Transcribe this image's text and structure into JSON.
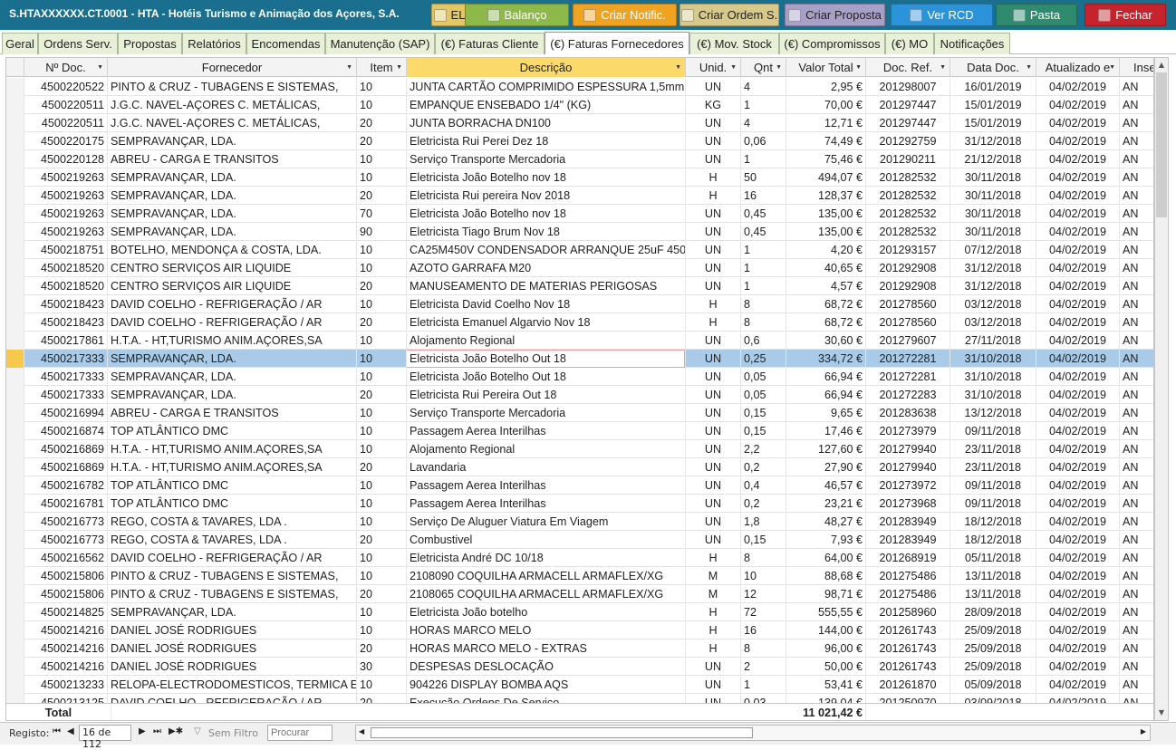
{
  "window": {
    "title": "S.HTAXXXXXX.CT.0001 - HTA - Hotéis Turismo e Animação dos Açores, S.A."
  },
  "toolbar": [
    {
      "key": "rel",
      "label": "EL",
      "icon": "document-icon",
      "bg": "#e3c763",
      "color": "#222"
    },
    {
      "key": "balanco",
      "label": "Balanço",
      "icon": "pie-chart-icon",
      "bg": "#8db94a",
      "color": "#fff"
    },
    {
      "key": "criar_notific",
      "label": "Criar Notific.",
      "icon": "checklist-icon",
      "bg": "#f0a320",
      "color": "#fff"
    },
    {
      "key": "criar_ordem",
      "label": "Criar Ordem S.",
      "icon": "clipboard-icon",
      "bg": "#d8c98a",
      "color": "#222"
    },
    {
      "key": "criar_proposta",
      "label": "Criar Proposta",
      "icon": "proposal-icon",
      "bg": "#a9a0c9",
      "color": "#222"
    },
    {
      "key": "ver_rcd",
      "label": "Ver RCD",
      "icon": "globe-icon",
      "bg": "#2b93d9",
      "color": "#fff"
    },
    {
      "key": "pasta",
      "label": "Pasta",
      "icon": "folder-icon",
      "bg": "#2e8b6e",
      "color": "#fff"
    },
    {
      "key": "fechar",
      "label": "Fechar",
      "icon": "close-icon",
      "bg": "#c7232c",
      "color": "#fff"
    }
  ],
  "tabs": [
    "Geral",
    "Ordens Serv.",
    "Propostas",
    "Relatórios",
    "Encomendas",
    "Manutenção (SAP)",
    "(€) Faturas Cliente",
    "(€) Faturas Fornecedores",
    "(€) Mov. Stock",
    "(€) Compromissos",
    "(€) MO",
    "Notificações"
  ],
  "active_tab": "(€) Faturas Fornecedores",
  "columns": [
    {
      "key": "doc",
      "label": "Nº Doc."
    },
    {
      "key": "forn",
      "label": "Fornecedor"
    },
    {
      "key": "item",
      "label": "Item"
    },
    {
      "key": "desc",
      "label": "Descrição"
    },
    {
      "key": "unid",
      "label": "Unid."
    },
    {
      "key": "qnt",
      "label": "Qnt"
    },
    {
      "key": "valor",
      "label": "Valor Total"
    },
    {
      "key": "ref",
      "label": "Doc. Ref."
    },
    {
      "key": "data",
      "label": "Data Doc."
    },
    {
      "key": "atual",
      "label": "Atualizado e"
    },
    {
      "key": "ins",
      "label": "Inser"
    }
  ],
  "rows": [
    [
      "4500220522",
      "PINTO & CRUZ - TUBAGENS E SISTEMAS,",
      "10",
      "JUNTA CARTÃO COMPRIMIDO ESPESSURA 1,5mm",
      "UN",
      "4",
      "2,95 €",
      "201298007",
      "16/01/2019",
      "04/02/2019",
      "AN"
    ],
    [
      "4500220511",
      "J.G.C. NAVEL-AÇORES C. METÁLICAS,",
      "10",
      "EMPANQUE ENSEBADO 1/4\" (KG)",
      "KG",
      "1",
      "70,00 €",
      "201297447",
      "15/01/2019",
      "04/02/2019",
      "AN"
    ],
    [
      "4500220511",
      "J.G.C. NAVEL-AÇORES C. METÁLICAS,",
      "20",
      "JUNTA BORRACHA DN100",
      "UN",
      "4",
      "12,71 €",
      "201297447",
      "15/01/2019",
      "04/02/2019",
      "AN"
    ],
    [
      "4500220175",
      "SEMPRAVANÇAR, LDA.",
      "20",
      "Eletricista Rui Perei Dez 18",
      "UN",
      "0,06",
      "74,49 €",
      "201292759",
      "31/12/2018",
      "04/02/2019",
      "AN"
    ],
    [
      "4500220128",
      "ABREU - CARGA E TRANSITOS",
      "10",
      "Serviço Transporte Mercadoria",
      "UN",
      "1",
      "75,46 €",
      "201290211",
      "21/12/2018",
      "04/02/2019",
      "AN"
    ],
    [
      "4500219263",
      "SEMPRAVANÇAR, LDA.",
      "10",
      "Eletricista João Botelho nov 18",
      "H",
      "50",
      "494,07 €",
      "201282532",
      "30/11/2018",
      "04/02/2019",
      "AN"
    ],
    [
      "4500219263",
      "SEMPRAVANÇAR, LDA.",
      "20",
      "Eletricista Rui pereira Nov 2018",
      "H",
      "16",
      "128,37 €",
      "201282532",
      "30/11/2018",
      "04/02/2019",
      "AN"
    ],
    [
      "4500219263",
      "SEMPRAVANÇAR, LDA.",
      "70",
      "Eletricista João Botelho nov 18",
      "UN",
      "0,45",
      "135,00 €",
      "201282532",
      "30/11/2018",
      "04/02/2019",
      "AN"
    ],
    [
      "4500219263",
      "SEMPRAVANÇAR, LDA.",
      "90",
      "Eletricista Tiago Brum Nov 18",
      "UN",
      "0,45",
      "135,00 €",
      "201282532",
      "30/11/2018",
      "04/02/2019",
      "AN"
    ],
    [
      "4500218751",
      "BOTELHO, MENDONÇA & COSTA, LDA.",
      "10",
      "CA25M450V CONDENSADOR ARRANQUE 25uF 450",
      "UN",
      "1",
      "4,20 €",
      "201293157",
      "07/12/2018",
      "04/02/2019",
      "AN"
    ],
    [
      "4500218520",
      "CENTRO SERVIÇOS AIR LIQUIDE",
      "10",
      "AZOTO GARRAFA M20",
      "UN",
      "1",
      "40,65 €",
      "201292908",
      "31/12/2018",
      "04/02/2019",
      "AN"
    ],
    [
      "4500218520",
      "CENTRO SERVIÇOS AIR LIQUIDE",
      "20",
      "MANUSEAMENTO DE MATERIAS PERIGOSAS",
      "UN",
      "1",
      "4,57 €",
      "201292908",
      "31/12/2018",
      "04/02/2019",
      "AN"
    ],
    [
      "4500218423",
      "DAVID COELHO - REFRIGERAÇÃO / AR",
      "10",
      "Eletricista David Coelho Nov 18",
      "H",
      "8",
      "68,72 €",
      "201278560",
      "03/12/2018",
      "04/02/2019",
      "AN"
    ],
    [
      "4500218423",
      "DAVID COELHO - REFRIGERAÇÃO / AR",
      "20",
      "Eletricista Emanuel Algarvio Nov 18",
      "H",
      "8",
      "68,72 €",
      "201278560",
      "03/12/2018",
      "04/02/2019",
      "AN"
    ],
    [
      "4500217861",
      "H.T.A. - HT,TURISMO ANIM.AÇORES,SA",
      "10",
      "Alojamento Regional",
      "UN",
      "0,6",
      "30,60 €",
      "201279607",
      "27/11/2018",
      "04/02/2019",
      "AN"
    ],
    [
      "4500217333",
      "SEMPRAVANÇAR, LDA.",
      "10",
      "Eletricista João Botelho Out 18",
      "UN",
      "0,25",
      "334,72 €",
      "201272281",
      "31/10/2018",
      "04/02/2019",
      "AN"
    ],
    [
      "4500217333",
      "SEMPRAVANÇAR, LDA.",
      "10",
      "Eletricista João Botelho Out 18",
      "UN",
      "0,05",
      "66,94 €",
      "201272281",
      "31/10/2018",
      "04/02/2019",
      "AN"
    ],
    [
      "4500217333",
      "SEMPRAVANÇAR, LDA.",
      "20",
      "Eletricista Rui Pereira Out 18",
      "UN",
      "0,05",
      "66,94 €",
      "201272283",
      "31/10/2018",
      "04/02/2019",
      "AN"
    ],
    [
      "4500216994",
      "ABREU - CARGA E TRANSITOS",
      "10",
      "Serviço Transporte Mercadoria",
      "UN",
      "0,15",
      "9,65 €",
      "201283638",
      "13/12/2018",
      "04/02/2019",
      "AN"
    ],
    [
      "4500216874",
      "TOP ATLÂNTICO DMC",
      "10",
      "Passagem Aerea Interilhas",
      "UN",
      "0,15",
      "17,46 €",
      "201273979",
      "09/11/2018",
      "04/02/2019",
      "AN"
    ],
    [
      "4500216869",
      "H.T.A. - HT,TURISMO ANIM.AÇORES,SA",
      "10",
      "Alojamento Regional",
      "UN",
      "2,2",
      "127,60 €",
      "201279940",
      "23/11/2018",
      "04/02/2019",
      "AN"
    ],
    [
      "4500216869",
      "H.T.A. - HT,TURISMO ANIM.AÇORES,SA",
      "20",
      "Lavandaria",
      "UN",
      "0,2",
      "27,90 €",
      "201279940",
      "23/11/2018",
      "04/02/2019",
      "AN"
    ],
    [
      "4500216782",
      "TOP ATLÂNTICO DMC",
      "10",
      "Passagem Aerea Interilhas",
      "UN",
      "0,4",
      "46,57 €",
      "201273972",
      "09/11/2018",
      "04/02/2019",
      "AN"
    ],
    [
      "4500216781",
      "TOP ATLÂNTICO DMC",
      "10",
      "Passagem Aerea Interilhas",
      "UN",
      "0,2",
      "23,21 €",
      "201273968",
      "09/11/2018",
      "04/02/2019",
      "AN"
    ],
    [
      "4500216773",
      "REGO, COSTA & TAVARES, LDA .",
      "10",
      "Serviço De Aluguer Viatura Em Viagem",
      "UN",
      "1,8",
      "48,27 €",
      "201283949",
      "18/12/2018",
      "04/02/2019",
      "AN"
    ],
    [
      "4500216773",
      "REGO, COSTA & TAVARES, LDA .",
      "20",
      "Combustivel",
      "UN",
      "0,15",
      "7,93 €",
      "201283949",
      "18/12/2018",
      "04/02/2019",
      "AN"
    ],
    [
      "4500216562",
      "DAVID COELHO - REFRIGERAÇÃO / AR",
      "10",
      "Eletricista André DC 10/18",
      "H",
      "8",
      "64,00 €",
      "201268919",
      "05/11/2018",
      "04/02/2019",
      "AN"
    ],
    [
      "4500215806",
      "PINTO & CRUZ - TUBAGENS E SISTEMAS,",
      "10",
      "2108090 COQUILHA ARMACELL ARMAFLEX/XG",
      "M",
      "10",
      "88,68 €",
      "201275486",
      "13/11/2018",
      "04/02/2019",
      "AN"
    ],
    [
      "4500215806",
      "PINTO & CRUZ - TUBAGENS E SISTEMAS,",
      "20",
      "2108065 COQUILHA ARMACELL ARMAFLEX/XG",
      "M",
      "12",
      "98,71 €",
      "201275486",
      "13/11/2018",
      "04/02/2019",
      "AN"
    ],
    [
      "4500214825",
      "SEMPRAVANÇAR, LDA.",
      "10",
      "Eletricista João botelho",
      "H",
      "72",
      "555,55 €",
      "201258960",
      "28/09/2018",
      "04/02/2019",
      "AN"
    ],
    [
      "4500214216",
      "DANIEL JOSÉ RODRIGUES",
      "10",
      "HORAS MARCO MELO",
      "H",
      "16",
      "144,00 €",
      "201261743",
      "25/09/2018",
      "04/02/2019",
      "AN"
    ],
    [
      "4500214216",
      "DANIEL JOSÉ RODRIGUES",
      "20",
      "HORAS MARCO MELO - EXTRAS",
      "H",
      "8",
      "96,00 €",
      "201261743",
      "25/09/2018",
      "04/02/2019",
      "AN"
    ],
    [
      "4500214216",
      "DANIEL JOSÉ RODRIGUES",
      "30",
      "DESPESAS DESLOCAÇÃO",
      "UN",
      "2",
      "50,00 €",
      "201261743",
      "25/09/2018",
      "04/02/2019",
      "AN"
    ],
    [
      "4500213233",
      "RELOPA-ELECTRODOMESTICOS, TERMICA E",
      "10",
      "904226 DISPLAY BOMBA AQS",
      "UN",
      "1",
      "53,41 €",
      "201261870",
      "05/09/2018",
      "04/02/2019",
      "AN"
    ],
    [
      "4500213125",
      "DAVID COELHO - REFRIGERAÇÃO / AR",
      "20",
      "Execução Ordens De Serviço",
      "UN",
      "0,03",
      "139,04 €",
      "201250970",
      "03/09/2018",
      "04/02/2019",
      "AN"
    ]
  ],
  "selected_row": 15,
  "total": {
    "label": "Total",
    "value": "11 021,42 €"
  },
  "statusbar": {
    "record_label": "Registo:",
    "record_value": "16 de 112",
    "filter_label": "Sem Filtro",
    "search_placeholder": "Procurar"
  }
}
